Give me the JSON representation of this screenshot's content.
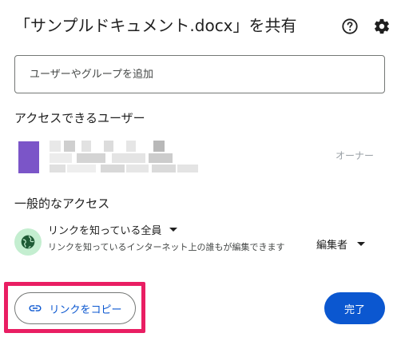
{
  "dialog": {
    "title": "「サンプルドキュメント.docx」を共有"
  },
  "icons": {
    "help": "help-circle-icon",
    "settings": "gear-icon",
    "globe": "globe-icon",
    "link": "link-icon"
  },
  "add_people": {
    "placeholder": "ユーザーやグループを追加"
  },
  "users_section": {
    "title": "アクセスできるユーザー",
    "owner": {
      "avatar_color": "#7b55c8",
      "role_label": "オーナー"
    }
  },
  "general_access": {
    "title": "一般的なアクセス",
    "type_label": "リンクを知っている全員",
    "description": "リンクを知っているインターネット上の誰もが編集できます",
    "role_label": "編集者",
    "icon_bg_color": "#c4eed0"
  },
  "footer": {
    "copy_link_label": "リンクをコピー",
    "done_label": "完了",
    "highlight_color": "#e91e63",
    "accent_color": "#0b57d0"
  }
}
